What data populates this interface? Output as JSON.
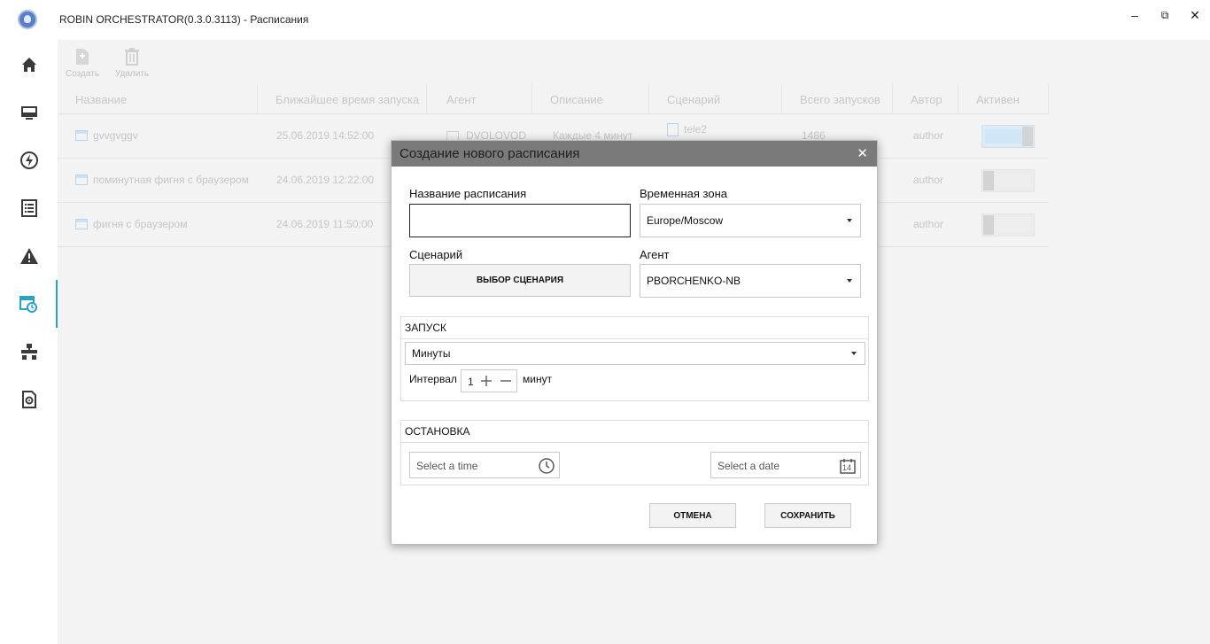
{
  "window": {
    "title": "ROBIN ORCHESTRATOR(0.3.0.3113) - Расписания",
    "controls": {
      "minimize": "‒",
      "restore": "⧉",
      "close": "✕"
    }
  },
  "sidebar": {
    "items": [
      {
        "name": "home-icon",
        "active": false
      },
      {
        "name": "monitor-icon",
        "active": false
      },
      {
        "name": "lightning-icon",
        "active": false
      },
      {
        "name": "document-list-icon",
        "active": false
      },
      {
        "name": "warning-icon",
        "active": false
      },
      {
        "name": "schedule-icon",
        "active": true
      },
      {
        "name": "network-icon",
        "active": false
      },
      {
        "name": "settings-file-icon",
        "active": false
      }
    ],
    "accent_color": "#2aa1c8"
  },
  "toolbar": {
    "create_label": "Создать",
    "delete_label": "Удалить"
  },
  "table": {
    "columns": [
      "Название",
      "Ближайшее время запуска",
      "Агент",
      "Описание",
      "Сценарий",
      "Всего запусков",
      "Автор",
      "Активен"
    ],
    "rows": [
      {
        "name": "gvvgvggv",
        "next_run": "25.06.2019 14:52:00",
        "agent": "DVOLOVOD",
        "description": "Каждые 4 минут",
        "scenario": "tele2",
        "runs": "1486",
        "author": "author",
        "active": true
      },
      {
        "name": "поминутная фигня с браузером",
        "next_run": "24.06.2019 12:22:00",
        "author": "author",
        "active": false
      },
      {
        "name": "фигня с браузером",
        "next_run": "24.06.2019 11:50:00",
        "author": "author",
        "active": false
      }
    ]
  },
  "dialog": {
    "title": "Создание нового расписания",
    "close": "✕",
    "name_label": "Название расписания",
    "name_value": "",
    "timezone_label": "Временная зона",
    "timezone_value": "Europe/Moscow",
    "scenario_label": "Сценарий",
    "scenario_button": "ВЫБОР СЦЕНАРИЯ",
    "agent_label": "Агент",
    "agent_value": "PBORCHENKO-NB",
    "launch": {
      "header": "ЗАПУСК",
      "period_value": "Минуты",
      "interval_label": "Интервал",
      "interval_value": "1",
      "interval_unit": "минут"
    },
    "stop": {
      "header": "ОСТАНОВКА",
      "time_placeholder": "Select a time",
      "date_placeholder": "Select a date",
      "calendar_day": "14"
    },
    "cancel_label": "ОТМЕНА",
    "save_label": "СОХРАНИТЬ"
  }
}
